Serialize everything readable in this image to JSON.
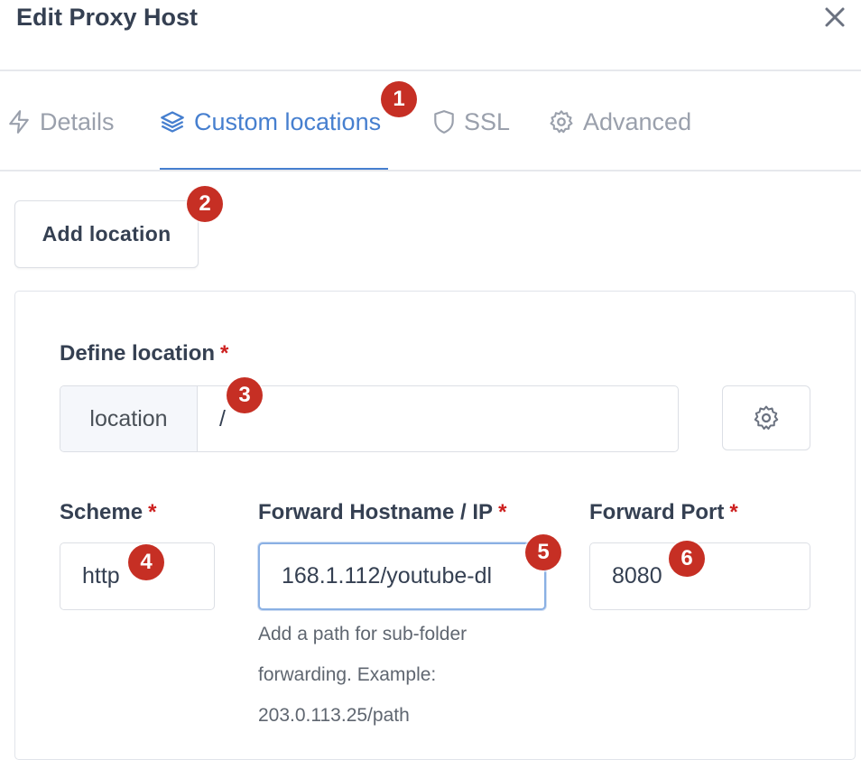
{
  "modal": {
    "title": "Edit Proxy Host"
  },
  "tabs": [
    {
      "label": "Details",
      "icon": "zap-icon",
      "active": false
    },
    {
      "label": "Custom locations",
      "icon": "layers-icon",
      "active": true
    },
    {
      "label": "SSL",
      "icon": "shield-icon",
      "active": false
    },
    {
      "label": "Advanced",
      "icon": "gear-icon",
      "active": false
    }
  ],
  "add_location_label": "Add location",
  "location": {
    "label": "Define location",
    "required_mark": "*",
    "addon": "location",
    "value": "/"
  },
  "scheme": {
    "label": "Scheme",
    "required_mark": "*",
    "value": "http"
  },
  "hostname": {
    "label": "Forward Hostname / IP",
    "required_mark": "*",
    "value": "168.1.112/youtube-dl",
    "help_lines": [
      "Add a path for sub-folder",
      "forwarding. Example:",
      "203.0.113.25/path"
    ]
  },
  "port": {
    "label": "Forward Port",
    "required_mark": "*",
    "value": "8080"
  },
  "markers": [
    "1",
    "2",
    "3",
    "4",
    "5",
    "6"
  ],
  "colors": {
    "accent": "#467fcf",
    "marker": "#c62f24",
    "required": "#cd201f",
    "muted_tab": "#9aa0ac"
  }
}
